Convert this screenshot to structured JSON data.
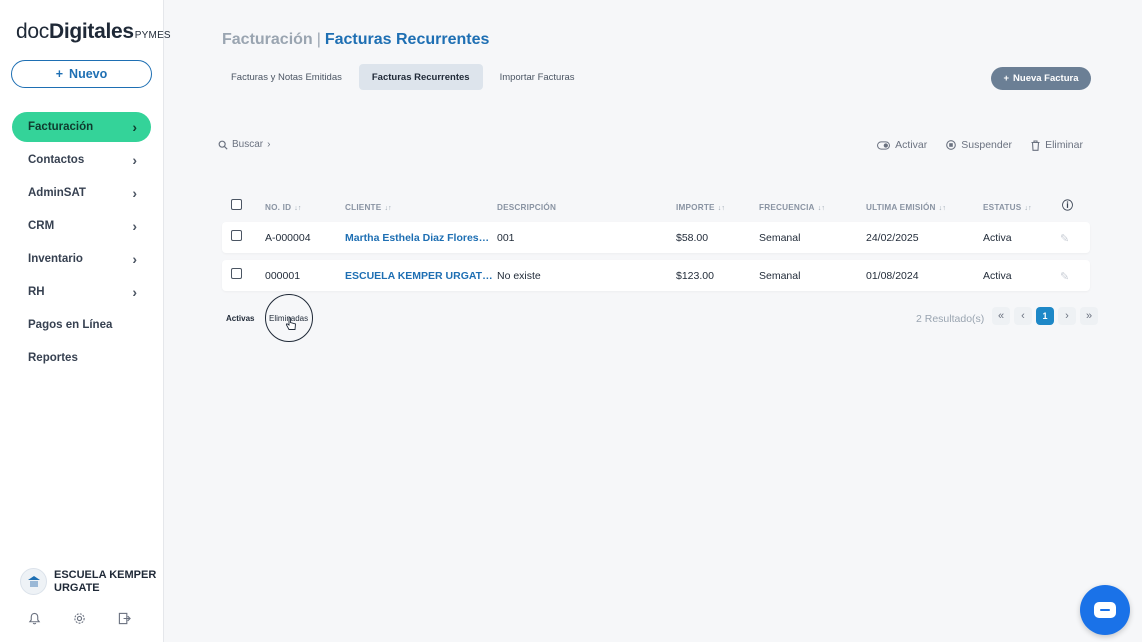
{
  "sidebar": {
    "logo": {
      "doc": "doc",
      "digitales": "Digitales",
      "pymes": "PYMES"
    },
    "new_button": {
      "icon": "+",
      "label": "Nuevo"
    },
    "items": [
      {
        "label": "Facturación",
        "chevron": "›"
      },
      {
        "label": "Contactos",
        "chevron": "›"
      },
      {
        "label": "AdminSAT",
        "chevron": "›"
      },
      {
        "label": "CRM",
        "chevron": "›"
      },
      {
        "label": "Inventario",
        "chevron": "›"
      },
      {
        "label": "RH",
        "chevron": "›"
      },
      {
        "label": "Pagos en Línea",
        "chevron": ""
      },
      {
        "label": "Reportes",
        "chevron": ""
      }
    ],
    "company": {
      "line1": "ESCUELA KEMPER",
      "line2": "URGATE"
    }
  },
  "header": {
    "section": "Facturación",
    "separator": "|",
    "current": "Facturas Recurrentes"
  },
  "tabs": [
    {
      "label": "Facturas y Notas Emitidas"
    },
    {
      "label": "Facturas Recurrentes"
    },
    {
      "label": "Importar Facturas"
    }
  ],
  "new_invoice_button": {
    "icon": "+",
    "label": "Nueva Factura"
  },
  "search": {
    "label": "Buscar",
    "arrow": "›"
  },
  "actions": {
    "activate": "Activar",
    "suspend": "Suspender",
    "delete": "Eliminar"
  },
  "table": {
    "headers": {
      "id": "NO. ID",
      "client": "CLIENTE",
      "description": "DESCRIPCIÓN",
      "amount": "IMPORTE",
      "frequency": "FRECUENCIA",
      "last_issue": "ULTIMA EMISIÓN",
      "status": "ESTATUS",
      "info": "ⓘ"
    },
    "sort_glyph": "↓↑",
    "rows": [
      {
        "id": "A-000004",
        "client": "Martha Esthela Diaz Flores…",
        "description": "001",
        "amount": "$58.00",
        "frequency": "Semanal",
        "last_issue": "24/02/2025",
        "status": "Activa",
        "edit": "✎"
      },
      {
        "id": "000001",
        "client": "ESCUELA KEMPER URGAT…",
        "description": "No existe",
        "amount": "$123.00",
        "frequency": "Semanal",
        "last_issue": "01/08/2024",
        "status": "Activa",
        "edit": "✎"
      }
    ]
  },
  "status_tabs": {
    "active": "Activas",
    "deleted": "Eliminadas"
  },
  "pagination": {
    "results": "2 Resultado(s)",
    "first": "«",
    "prev": "‹",
    "page": "1",
    "next": "›",
    "last": "»"
  },
  "colors": {
    "accent": "#1e6fb3",
    "active_nav": "#34d399",
    "primary_button": "#6b7f95",
    "chat": "#1a72e8"
  }
}
